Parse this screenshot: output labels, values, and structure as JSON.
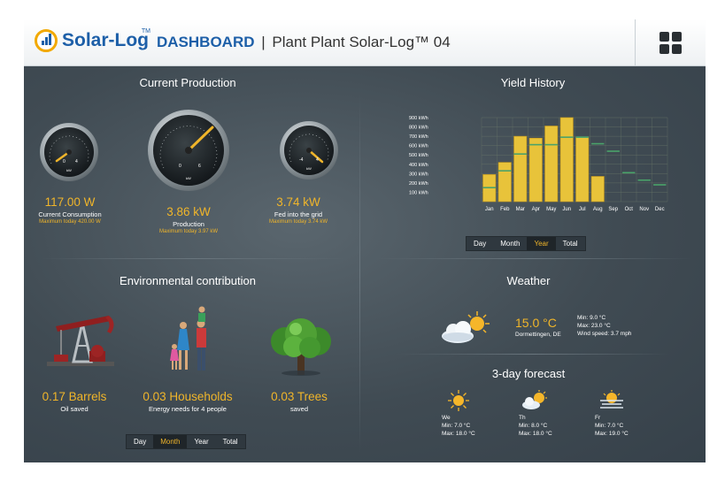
{
  "header": {
    "logo_text": "Solar-Log",
    "logo_tm": "TM",
    "dashboard_label": "DASHBOARD",
    "separator": "|",
    "plant_name": "Plant Plant Solar-Log™ 04"
  },
  "current_production": {
    "title": "Current Production",
    "gauges": [
      {
        "value": "117.00 W",
        "label": "Current Consumption",
        "max": "Maximum today 420.00 W",
        "unit": "kW",
        "ticks": [
          "0",
          "4"
        ]
      },
      {
        "value": "3.86 kW",
        "label": "Production",
        "max": "Maximum today 3.97 kW",
        "unit": "kW",
        "ticks": [
          "0",
          "6"
        ]
      },
      {
        "value": "3.74 kW",
        "label": "Fed into the grid",
        "max": "Maximum today 3.74 kW",
        "unit": "kW",
        "ticks": [
          "-4",
          "4"
        ]
      }
    ]
  },
  "yield_history": {
    "title": "Yield History",
    "tabs": [
      "Day",
      "Month",
      "Year",
      "Total"
    ],
    "active_tab": "Year"
  },
  "chart_data": {
    "type": "bar",
    "categories": [
      "Jan",
      "Feb",
      "Mar",
      "Apr",
      "May",
      "Jun",
      "Jul",
      "Aug",
      "Sep",
      "Oct",
      "Nov",
      "Dec"
    ],
    "series": [
      {
        "values": [
          290,
          420,
          700,
          680,
          810,
          900,
          690,
          270,
          null,
          null,
          null,
          null
        ]
      },
      {
        "values": [
          150,
          330,
          510,
          610,
          610,
          690,
          690,
          620,
          540,
          310,
          230,
          180
        ]
      }
    ],
    "yticks": [
      "900 kWh",
      "800 kWh",
      "700 kWh",
      "600 kWh",
      "500 kWh",
      "400 kWh",
      "300 kWh",
      "200 kWh",
      "100 kWh"
    ],
    "ylim": [
      0,
      900
    ],
    "bar_color": "#e8c33a",
    "target_color": "#4aa36a"
  },
  "environmental": {
    "title": "Environmental contribution",
    "items": [
      {
        "value": "0.17 Barrels",
        "label": "Oil saved"
      },
      {
        "value": "0.03 Households",
        "label": "Energy needs for 4 people"
      },
      {
        "value": "0.03 Trees",
        "label": "saved"
      }
    ],
    "tabs": [
      "Day",
      "Month",
      "Year",
      "Total"
    ],
    "active_tab": "Month"
  },
  "weather": {
    "title": "Weather",
    "temp": "15.0 °C",
    "location": "Dormettingen, DE",
    "min": "Min: 9.0 °C",
    "max": "Max: 23.0 °C",
    "wind": "Wind speed: 3.7 mph",
    "forecast_title": "3-day forecast",
    "forecast": [
      {
        "day": "We",
        "min": "Min: 7.0 °C",
        "max": "Max: 18.0 °C",
        "icon": "sun-icon"
      },
      {
        "day": "Th",
        "min": "Min: 8.0 °C",
        "max": "Max: 18.0 °C",
        "icon": "partly-cloudy-icon"
      },
      {
        "day": "Fr",
        "min": "Min: 7.0 °C",
        "max": "Max: 19.0 °C",
        "icon": "fog-sun-icon"
      }
    ]
  }
}
